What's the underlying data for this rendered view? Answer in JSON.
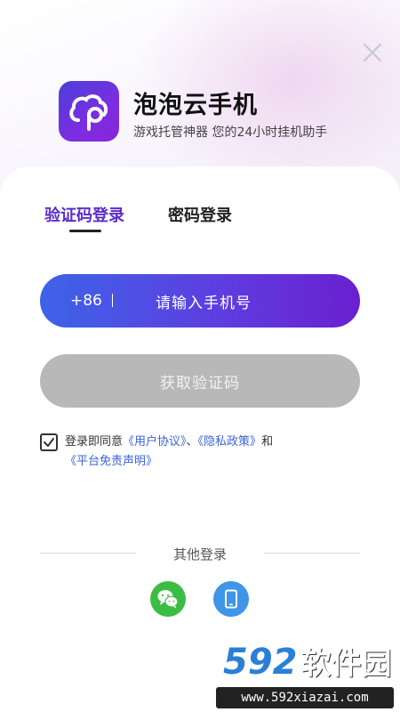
{
  "header": {
    "app_title": "泡泡云手机",
    "app_slogan": "游戏托管神器  您的24小时挂机助手"
  },
  "tabs": {
    "sms_login": "验证码登录",
    "password_login": "密码登录"
  },
  "phone_field": {
    "country_code": "+86",
    "placeholder": "请输入手机号"
  },
  "get_code_button": "获取验证码",
  "agreement": {
    "prefix": "登录即同意",
    "user_agreement": "《用户协议》",
    "sep": "、",
    "privacy_policy": "《隐私政策》",
    "and": "和",
    "disclaimer": "《平台免责声明》",
    "checked": true
  },
  "other_login": {
    "label": "其他登录",
    "methods": [
      "wechat-icon",
      "phone-icon"
    ]
  },
  "watermark": {
    "logo_number": "592",
    "logo_text": "软件园",
    "url": "www.592xiazai.com"
  },
  "colors": {
    "accent": "#5b2bc7",
    "link": "#3b63d8",
    "wechat": "#3bbd45",
    "phone": "#3f95e6",
    "disabled_button": "#b8b8b8"
  }
}
